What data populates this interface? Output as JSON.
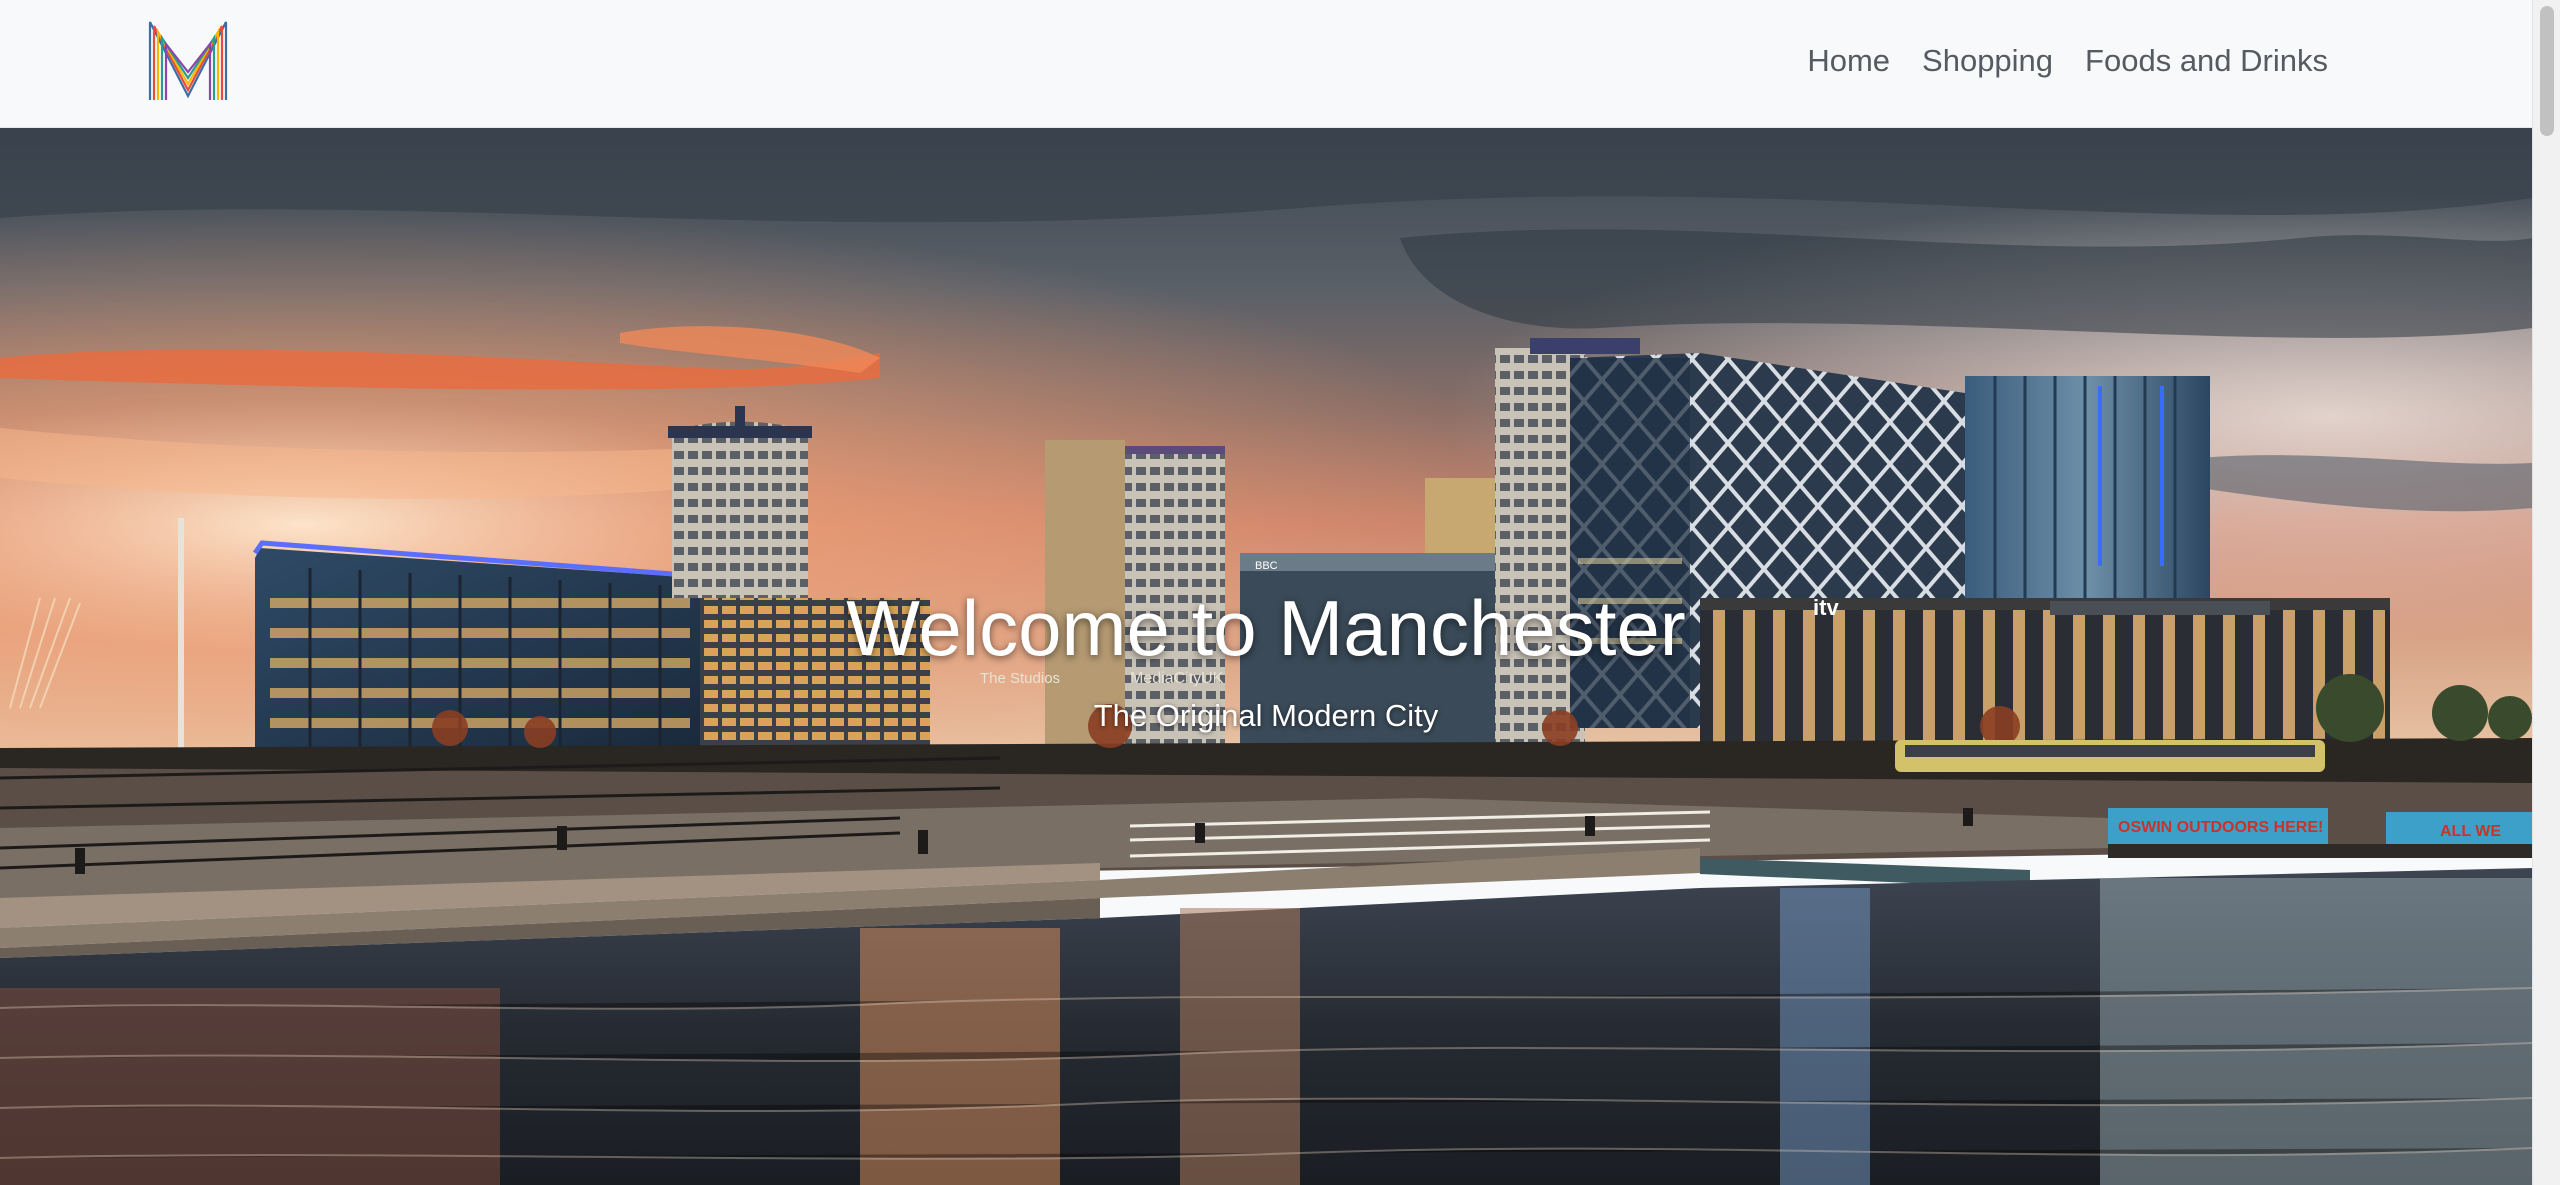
{
  "brand": {
    "logo_icon": "m-monogram-logo",
    "logo_colors": [
      "#e94b3c",
      "#f5b700",
      "#2a9d8f",
      "#3a6ea5",
      "#8e44ad"
    ]
  },
  "nav": {
    "items": [
      {
        "label": "Home"
      },
      {
        "label": "Shopping"
      },
      {
        "label": "Foods and Drinks"
      }
    ]
  },
  "hero": {
    "title": "Welcome to Manchester",
    "subtitle": "The Original Modern City",
    "image_icon": "manchester-skyline-photo",
    "sign_texts": [
      "The Studios",
      "MediaCityUK",
      "BBC",
      "itv"
    ],
    "banner_texts": [
      "OSWIN OUTDOORS HERE!",
      "ALL WE"
    ]
  },
  "colors": {
    "nav_bg": "#f8f9fa",
    "nav_text": "#555b61",
    "hero_text": "#ffffff"
  }
}
